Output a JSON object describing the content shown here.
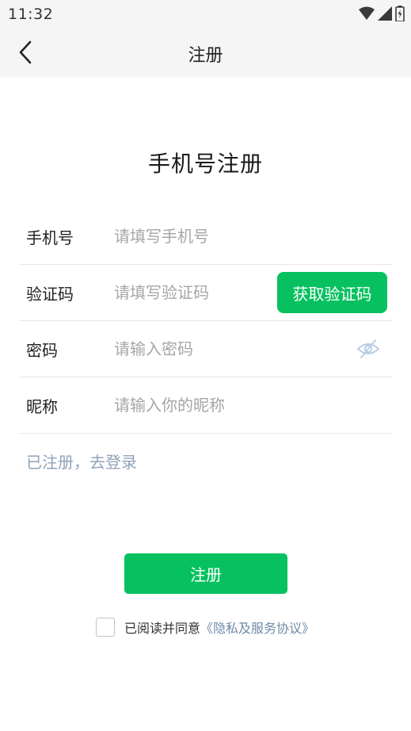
{
  "status_bar": {
    "time": "11:32"
  },
  "app_bar": {
    "title": "注册"
  },
  "heading": "手机号注册",
  "form": {
    "phone": {
      "label": "手机号",
      "placeholder": "请填写手机号"
    },
    "code": {
      "label": "验证码",
      "placeholder": "请填写验证码",
      "button_label": "获取验证码"
    },
    "password": {
      "label": "密码",
      "placeholder": "请输入密码"
    },
    "nickname": {
      "label": "昵称",
      "placeholder": "请输入你的昵称"
    }
  },
  "login_link": "已注册，去登录",
  "submit_label": "注册",
  "agreement": {
    "text": "已阅读并同意",
    "link": "《隐私及服务协议》"
  },
  "colors": {
    "accent": "#07c160",
    "link": "#8fa3b8",
    "placeholder": "#a6a6a6"
  },
  "icons": [
    "back-chevron-icon",
    "wifi-icon",
    "signal-icon",
    "battery-icon",
    "eye-off-icon"
  ]
}
